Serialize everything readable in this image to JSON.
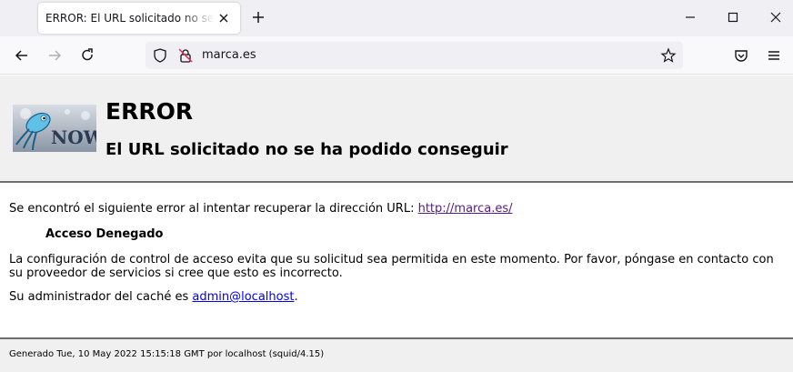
{
  "browser": {
    "tab_title": "ERROR: El URL solicitado no se ha podido conseguir",
    "url": "marca.es"
  },
  "error_page": {
    "title": "ERROR",
    "subtitle": "El URL solicitado no se ha podido conseguir",
    "logo_text": "NOW",
    "intro_text": "Se encontró el siguiente error al intentar recuperar la dirección URL: ",
    "requested_url": "http://marca.es/",
    "error_name": "Acceso Denegado",
    "explanation": "La configuración de control de acceso evita que su solicitud sea permitida en este momento. Por favor, póngase en contacto con su proveedor de servicios si cree que esto es incorrecto.",
    "admin_prefix": "Su administrador del caché es ",
    "admin_email": "admin@localhost",
    "admin_suffix": ".",
    "footer": "Generado Tue, 10 May 2022 15:15:18 GMT por localhost (squid/4.15)"
  }
}
